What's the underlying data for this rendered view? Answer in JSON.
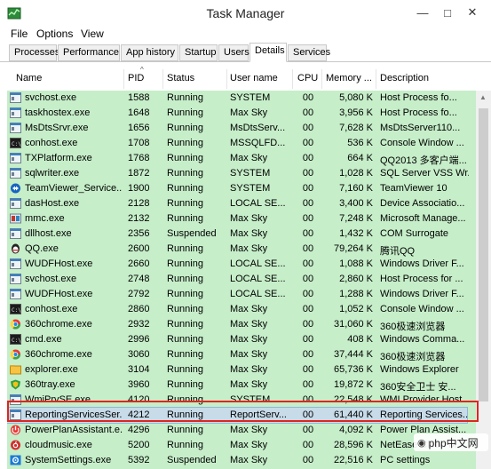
{
  "window": {
    "title": "Task Manager",
    "minimize": "—",
    "maximize": "□",
    "close": "✕"
  },
  "menu": [
    "File",
    "Options",
    "View"
  ],
  "tabs": [
    {
      "label": "Processes",
      "active": false
    },
    {
      "label": "Performance",
      "active": false
    },
    {
      "label": "App history",
      "active": false
    },
    {
      "label": "Startup",
      "active": false
    },
    {
      "label": "Users",
      "active": false
    },
    {
      "label": "Details",
      "active": true
    },
    {
      "label": "Services",
      "active": false
    }
  ],
  "columns": [
    "Name",
    "PID",
    "Status",
    "User name",
    "CPU",
    "Memory ...",
    "Description"
  ],
  "sort_indicator": "^",
  "rows": [
    {
      "name": "svchost.exe",
      "pid": "1588",
      "status": "Running",
      "user": "SYSTEM",
      "cpu": "00",
      "mem": "5,080 K",
      "desc": "Host Process fo...",
      "icon": "service-icon"
    },
    {
      "name": "taskhostex.exe",
      "pid": "1648",
      "status": "Running",
      "user": "Max Sky",
      "cpu": "00",
      "mem": "3,956 K",
      "desc": "Host Process fo...",
      "icon": "service-icon"
    },
    {
      "name": "MsDtsSrvr.exe",
      "pid": "1656",
      "status": "Running",
      "user": "MsDtsServ...",
      "cpu": "00",
      "mem": "7,628 K",
      "desc": "MsDtsServer110...",
      "icon": "service-icon"
    },
    {
      "name": "conhost.exe",
      "pid": "1708",
      "status": "Running",
      "user": "MSSQLFD...",
      "cpu": "00",
      "mem": "536 K",
      "desc": "Console Window ...",
      "icon": "console-icon"
    },
    {
      "name": "TXPlatform.exe",
      "pid": "1768",
      "status": "Running",
      "user": "Max Sky",
      "cpu": "00",
      "mem": "664 K",
      "desc": "QQ2013 多客户端...",
      "icon": "service-icon"
    },
    {
      "name": "sqlwriter.exe",
      "pid": "1872",
      "status": "Running",
      "user": "SYSTEM",
      "cpu": "00",
      "mem": "1,028 K",
      "desc": "SQL Server VSS Wr...",
      "icon": "service-icon"
    },
    {
      "name": "TeamViewer_Service....",
      "pid": "1900",
      "status": "Running",
      "user": "SYSTEM",
      "cpu": "00",
      "mem": "7,160 K",
      "desc": "TeamViewer 10",
      "icon": "teamviewer-icon"
    },
    {
      "name": "dasHost.exe",
      "pid": "2128",
      "status": "Running",
      "user": "LOCAL SE...",
      "cpu": "00",
      "mem": "3,400 K",
      "desc": "Device Associatio...",
      "icon": "service-icon"
    },
    {
      "name": "mmc.exe",
      "pid": "2132",
      "status": "Running",
      "user": "Max Sky",
      "cpu": "00",
      "mem": "7,248 K",
      "desc": "Microsoft Manage...",
      "icon": "mmc-icon"
    },
    {
      "name": "dllhost.exe",
      "pid": "2356",
      "status": "Suspended",
      "user": "Max Sky",
      "cpu": "00",
      "mem": "1,432 K",
      "desc": "COM Surrogate",
      "icon": "service-icon"
    },
    {
      "name": "QQ.exe",
      "pid": "2600",
      "status": "Running",
      "user": "Max Sky",
      "cpu": "00",
      "mem": "79,264 K",
      "desc": "腾讯QQ",
      "icon": "qq-icon"
    },
    {
      "name": "WUDFHost.exe",
      "pid": "2660",
      "status": "Running",
      "user": "LOCAL SE...",
      "cpu": "00",
      "mem": "1,088 K",
      "desc": "Windows Driver F...",
      "icon": "service-icon"
    },
    {
      "name": "svchost.exe",
      "pid": "2748",
      "status": "Running",
      "user": "LOCAL SE...",
      "cpu": "00",
      "mem": "2,860 K",
      "desc": "Host Process for ...",
      "icon": "service-icon"
    },
    {
      "name": "WUDFHost.exe",
      "pid": "2792",
      "status": "Running",
      "user": "LOCAL SE...",
      "cpu": "00",
      "mem": "1,288 K",
      "desc": "Windows Driver F...",
      "icon": "service-icon"
    },
    {
      "name": "conhost.exe",
      "pid": "2860",
      "status": "Running",
      "user": "Max Sky",
      "cpu": "00",
      "mem": "1,052 K",
      "desc": "Console Window ...",
      "icon": "console-icon"
    },
    {
      "name": "360chrome.exe",
      "pid": "2932",
      "status": "Running",
      "user": "Max Sky",
      "cpu": "00",
      "mem": "31,060 K",
      "desc": "360极速浏览器",
      "icon": "chrome360-icon"
    },
    {
      "name": "cmd.exe",
      "pid": "2996",
      "status": "Running",
      "user": "Max Sky",
      "cpu": "00",
      "mem": "408 K",
      "desc": "Windows Comma...",
      "icon": "console-icon"
    },
    {
      "name": "360chrome.exe",
      "pid": "3060",
      "status": "Running",
      "user": "Max Sky",
      "cpu": "00",
      "mem": "37,444 K",
      "desc": "360极速浏览器",
      "icon": "chrome360-icon"
    },
    {
      "name": "explorer.exe",
      "pid": "3104",
      "status": "Running",
      "user": "Max Sky",
      "cpu": "00",
      "mem": "65,736 K",
      "desc": "Windows Explorer",
      "icon": "explorer-icon"
    },
    {
      "name": "360tray.exe",
      "pid": "3960",
      "status": "Running",
      "user": "Max Sky",
      "cpu": "00",
      "mem": "19,872 K",
      "desc": "360安全卫士 安...",
      "icon": "tray360-icon"
    },
    {
      "name": "WmiPrvSE.exe",
      "pid": "4120",
      "status": "Running",
      "user": "SYSTEM",
      "cpu": "00",
      "mem": "22,548 K",
      "desc": "WMI Provider Host",
      "icon": "service-icon"
    },
    {
      "name": "ReportingServicesSer...",
      "pid": "4212",
      "status": "Running",
      "user": "ReportServ...",
      "cpu": "00",
      "mem": "61,440 K",
      "desc": "Reporting Services...",
      "icon": "service-icon",
      "selected": true
    },
    {
      "name": "PowerPlanAssistant.e...",
      "pid": "4296",
      "status": "Running",
      "user": "Max Sky",
      "cpu": "00",
      "mem": "4,092 K",
      "desc": "Power Plan Assist...",
      "icon": "powerplan-icon"
    },
    {
      "name": "cloudmusic.exe",
      "pid": "5200",
      "status": "Running",
      "user": "Max Sky",
      "cpu": "00",
      "mem": "28,596 K",
      "desc": "NetEase Cloud M...",
      "icon": "cloudmusic-icon"
    },
    {
      "name": "SystemSettings.exe",
      "pid": "5392",
      "status": "Suspended",
      "user": "Max Sky",
      "cpu": "00",
      "mem": "22,516 K",
      "desc": "PC settings",
      "icon": "settings-icon"
    }
  ],
  "watermark": "php中文网",
  "colors": {
    "row_bg": "#c6eec9",
    "selected_bg": "#c7dbe9",
    "highlight": "#e0251f"
  }
}
